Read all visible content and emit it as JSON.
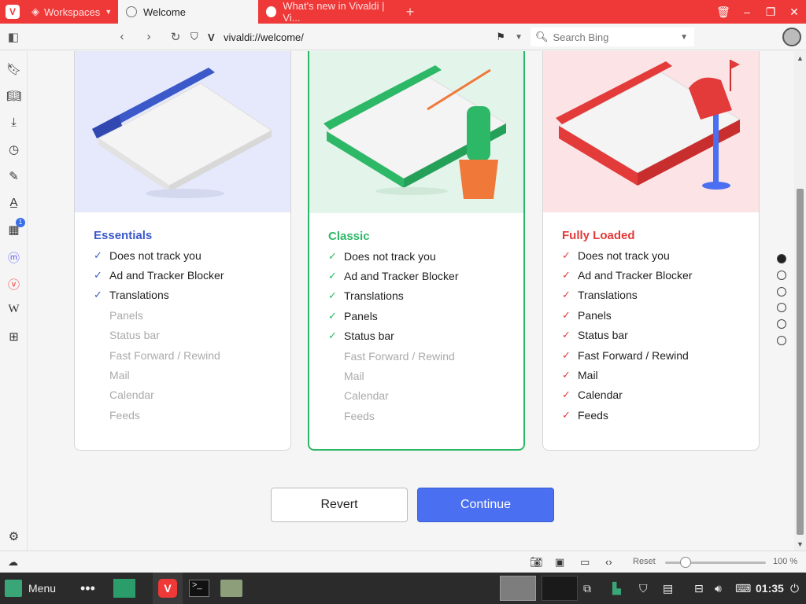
{
  "tabs": {
    "workspaces": "Workspaces",
    "active": "Welcome",
    "inactive": "What's new in Vivaldi | Vi..."
  },
  "address": {
    "url": "vivaldi://welcome/",
    "search_placeholder": "Search Bing"
  },
  "cards": [
    {
      "title": "Essentials",
      "accent": "#3b59c9",
      "features": [
        {
          "label": "Does not track you",
          "on": true
        },
        {
          "label": "Ad and Tracker Blocker",
          "on": true
        },
        {
          "label": "Translations",
          "on": true
        },
        {
          "label": "Panels",
          "on": false
        },
        {
          "label": "Status bar",
          "on": false
        },
        {
          "label": "Fast Forward / Rewind",
          "on": false
        },
        {
          "label": "Mail",
          "on": false
        },
        {
          "label": "Calendar",
          "on": false
        },
        {
          "label": "Feeds",
          "on": false
        }
      ]
    },
    {
      "title": "Classic",
      "accent": "#2cb866",
      "features": [
        {
          "label": "Does not track you",
          "on": true
        },
        {
          "label": "Ad and Tracker Blocker",
          "on": true
        },
        {
          "label": "Translations",
          "on": true
        },
        {
          "label": "Panels",
          "on": true
        },
        {
          "label": "Status bar",
          "on": true
        },
        {
          "label": "Fast Forward / Rewind",
          "on": false
        },
        {
          "label": "Mail",
          "on": false
        },
        {
          "label": "Calendar",
          "on": false
        },
        {
          "label": "Feeds",
          "on": false
        }
      ]
    },
    {
      "title": "Fully Loaded",
      "accent": "#e33a3a",
      "features": [
        {
          "label": "Does not track you",
          "on": true
        },
        {
          "label": "Ad and Tracker Blocker",
          "on": true
        },
        {
          "label": "Translations",
          "on": true
        },
        {
          "label": "Panels",
          "on": true
        },
        {
          "label": "Status bar",
          "on": true
        },
        {
          "label": "Fast Forward / Rewind",
          "on": true
        },
        {
          "label": "Mail",
          "on": true
        },
        {
          "label": "Calendar",
          "on": true
        },
        {
          "label": "Feeds",
          "on": true
        }
      ]
    }
  ],
  "buttons": {
    "revert": "Revert",
    "continue": "Continue"
  },
  "pager": {
    "count": 6,
    "current": 0
  },
  "statusbar": {
    "reset": "Reset",
    "zoom": "100 %"
  },
  "sidebar_badge": "1",
  "taskbar": {
    "menu": "Menu",
    "clock": "01:35"
  },
  "colors": {
    "brand": "#ef3939",
    "continue": "#4a6ff0"
  }
}
